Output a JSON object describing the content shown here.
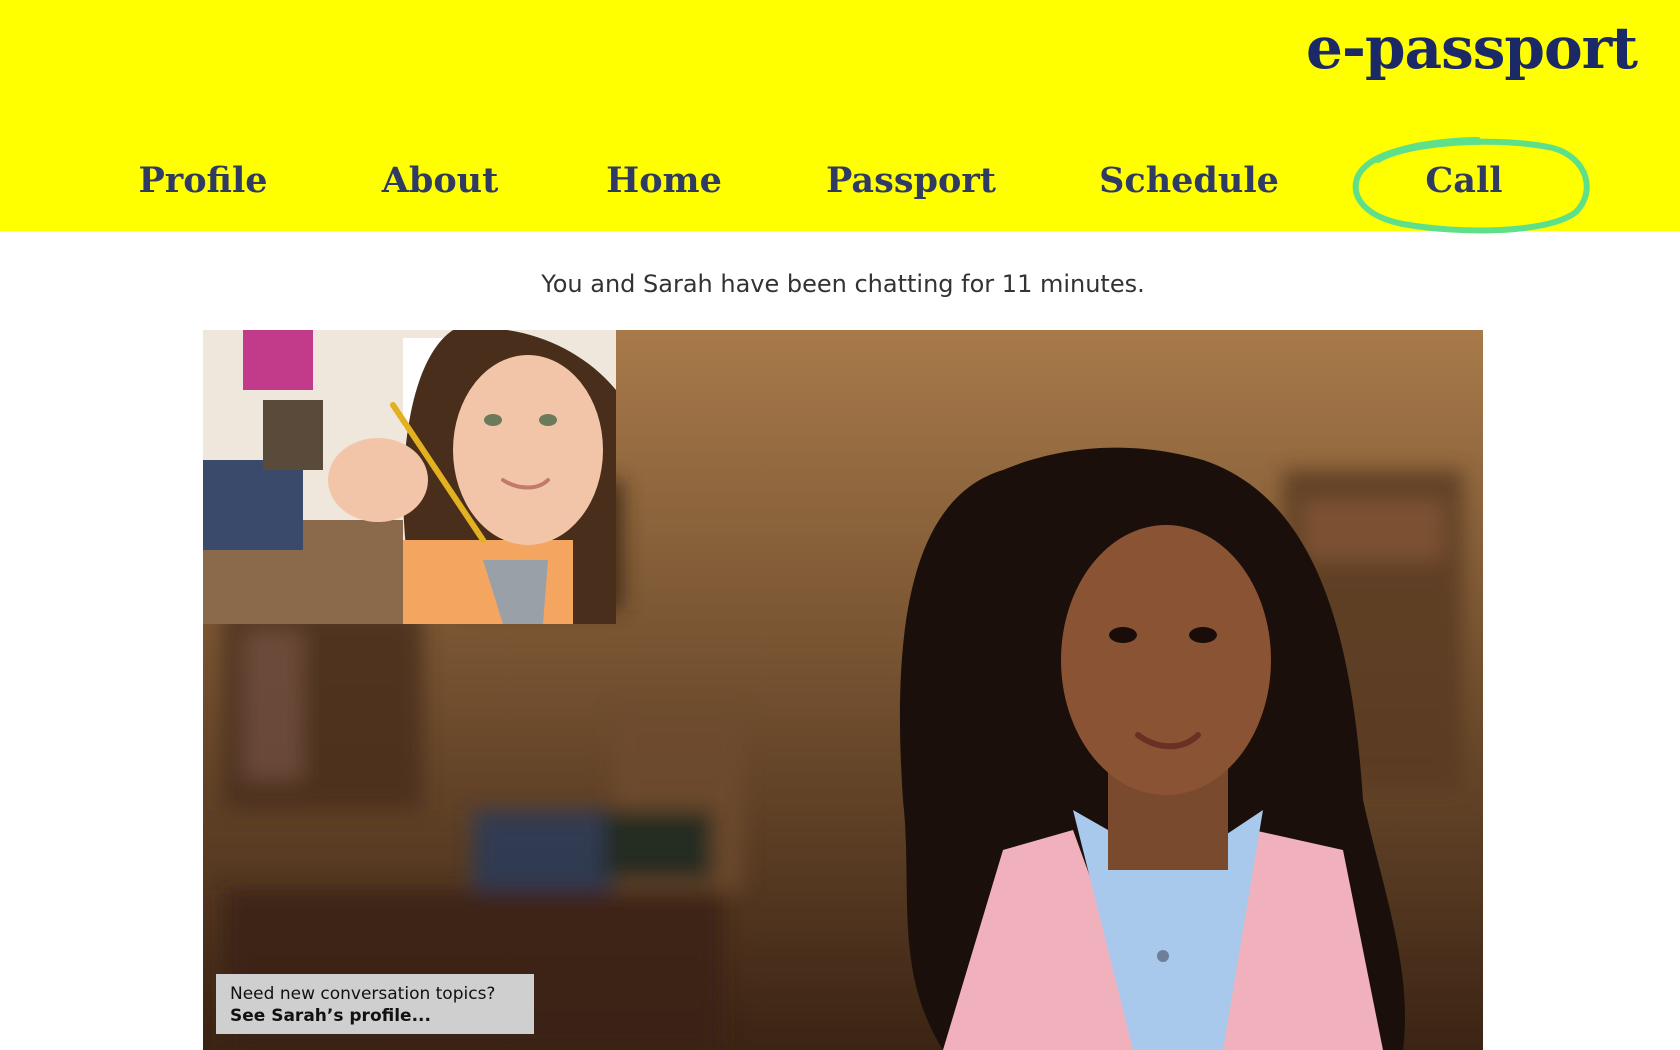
{
  "brand": {
    "logo_text": "e-passport",
    "header_color": "#ffff00",
    "logo_color": "#1b2a66",
    "nav_color": "#2f3b63",
    "highlight_color": "#5ee08a"
  },
  "nav": {
    "items": [
      {
        "label": "Profile",
        "active": false
      },
      {
        "label": "About",
        "active": false
      },
      {
        "label": "Home",
        "active": false
      },
      {
        "label": "Passport",
        "active": false
      },
      {
        "label": "Schedule",
        "active": false
      },
      {
        "label": "Call",
        "active": true
      }
    ]
  },
  "call": {
    "status_text": "You and Sarah have been chatting for 11 minutes.",
    "remote_video": "remote-participant-video",
    "self_video": "self-view-video",
    "tip": {
      "line1": "Need new conversation topics?",
      "line2": "See Sarah’s profile..."
    }
  }
}
